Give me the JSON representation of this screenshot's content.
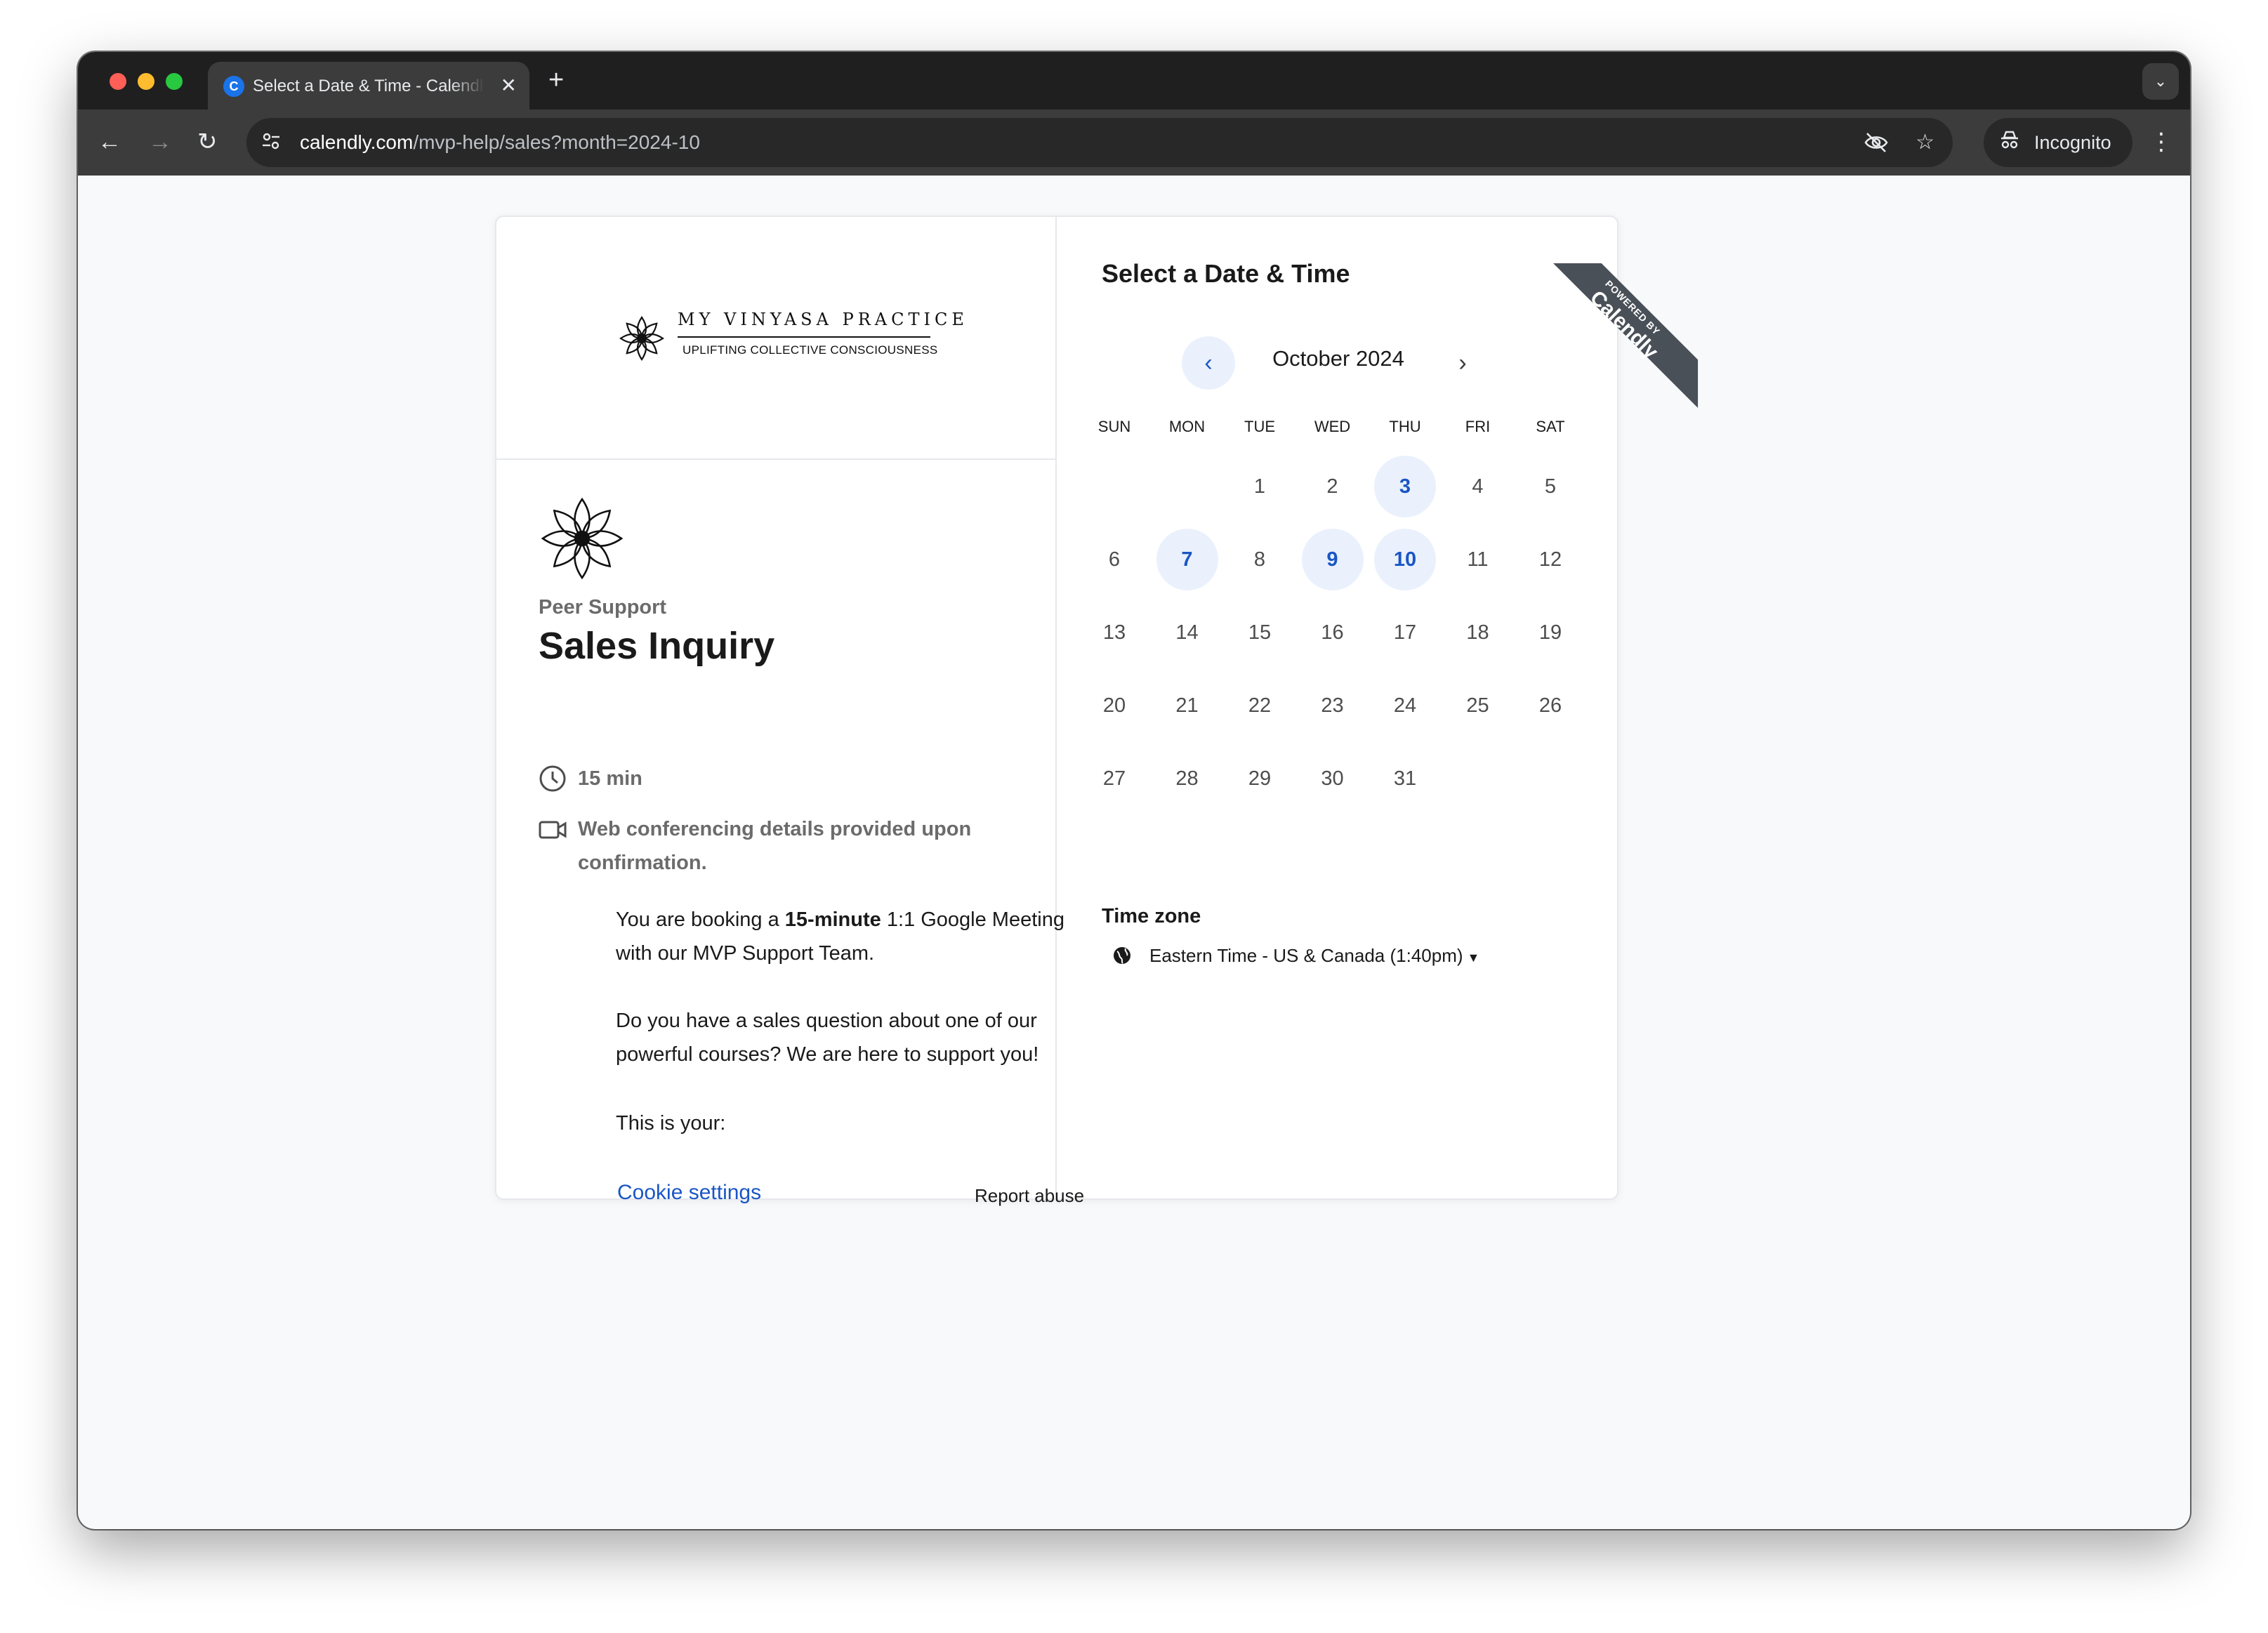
{
  "browser": {
    "tab_title": "Select a Date & Time - Calendly",
    "tab_favicon": "C",
    "url_host": "calendly.com",
    "url_path": "/mvp-help/sales?month=2024-10",
    "incognito_label": "Incognito"
  },
  "brand": {
    "name": "MY VINYASA PRACTICE",
    "tagline": "UPLIFTING COLLECTIVE CONSCIOUSNESS"
  },
  "event": {
    "organizer": "Peer Support",
    "title": "Sales Inquiry",
    "duration": "15 min",
    "conferencing": "Web conferencing details provided upon confirmation.",
    "desc1_prefix": "You are booking a ",
    "desc1_bold": "15-minute",
    "desc1_suffix": " 1:1 Google Meeting with our MVP Support Team.",
    "desc2": "Do you have a sales question about one of our powerful courses? We are here to support you!",
    "desc3": "This is your:"
  },
  "footer": {
    "cookie_settings": "Cookie settings",
    "report_abuse": "Report abuse"
  },
  "calendar": {
    "heading": "Select a Date & Time",
    "month_label": "October 2024",
    "weekdays": [
      "SUN",
      "MON",
      "TUE",
      "WED",
      "THU",
      "FRI",
      "SAT"
    ],
    "first_weekday_index": 2,
    "days_in_month": 31,
    "available_days": [
      3,
      7,
      9,
      10
    ]
  },
  "timezone": {
    "title": "Time zone",
    "value": "Eastern Time - US & Canada (1:40pm)"
  },
  "ribbon": {
    "line1": "POWERED BY",
    "line2": "Calendly"
  },
  "colors": {
    "accent": "#1a56c4",
    "available_bg": "#eaf1fd",
    "ribbon": "#4a5058"
  }
}
